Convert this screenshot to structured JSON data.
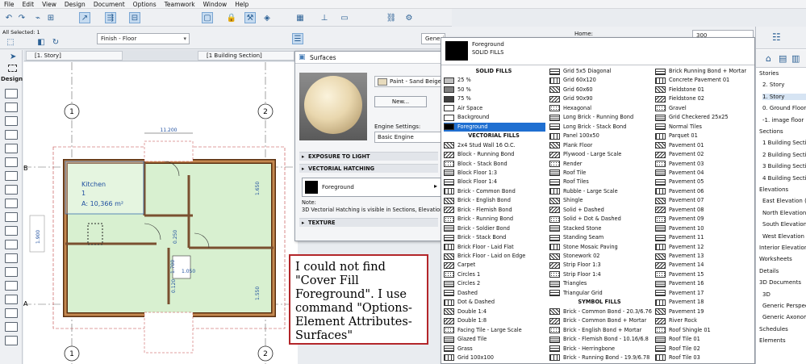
{
  "menu": [
    "File",
    "Edit",
    "View",
    "Design",
    "Document",
    "Options",
    "Teamwork",
    "Window",
    "Help"
  ],
  "infobox": {
    "selection": "All Selected: 1",
    "layer": "Finish - Floor",
    "home_label": "Home:",
    "home_value": "300",
    "generic": "Generic"
  },
  "tabs": [
    "[1. Story]",
    "[1 Building Section]"
  ],
  "left_panel_label": "Design",
  "plan": {
    "room_name": "Kitchen",
    "room_number": "1",
    "room_area": "A: 10,366 m²",
    "grid_labels": [
      "1",
      "2",
      "1",
      "2"
    ],
    "dims": [
      "11.200",
      "1.650",
      "1.550",
      "1.900",
      "0.250",
      "1.700",
      "1.050",
      "0.120"
    ],
    "side_labels": [
      "B",
      "A"
    ]
  },
  "surfaces_dialog": {
    "title": "Surfaces",
    "material_name": "Paint - Sand Beige",
    "new_button": "New...",
    "engine_label": "Engine Settings:",
    "engine_value": "Basic Engine",
    "sections": [
      "EXPOSURE TO LIGHT",
      "VECTORIAL HATCHING",
      "TEXTURE"
    ],
    "hatch_value": "Foreground",
    "note_label": "Note:",
    "note_text": "3D Vectorial Hatching is visible in Sections, Elevation"
  },
  "palette": {
    "header_name": "Foreground",
    "header_sub": "SOLID FILLS",
    "selected": "Foreground",
    "col1": [
      {
        "h": "SOLID FILLS"
      },
      "25 %",
      "50 %",
      "75 %",
      "Air Space",
      "Background",
      "Foreground",
      {
        "h": "VECTORIAL FILLS"
      },
      "2x4 Stud Wall 16 O.C.",
      "Block - Running Bond",
      "Block - Stack Bond",
      "Block Floor 1:3",
      "Block Floor 1:4",
      "Brick - Common Bond",
      "Brick - English Bond",
      "Brick - Flemish Bond",
      "Brick - Running Bond",
      "Brick - Soldier Bond",
      "Brick - Stack Bond",
      "Brick Floor - Laid Flat",
      "Brick Floor - Laid on Edge",
      "Carpet",
      "Circles 1",
      "Circles 2",
      "Dashed",
      "Dot & Dashed",
      "Double 1:4",
      "Double 1:8",
      "Facing Tile - Large Scale",
      "Glazed Tile",
      "Grass",
      "Grid 100x100"
    ],
    "col2": [
      "Grid 5x5 Diagonal",
      "Grid 60x120",
      "Grid 60x60",
      "Grid 90x90",
      "Hexagonal",
      "Long Brick - Running Bond",
      "Long Brick - Stack Bond",
      "Panel 100x50",
      "Plank Floor",
      "Plywood - Large Scale",
      "Render",
      "Roof Tile",
      "Roof Tiles",
      "Rubble - Large Scale",
      "Shingle",
      "Solid + Dashed",
      "Solid + Dot & Dashed",
      "Stacked Stone",
      "Standing Seam",
      "Stone Mosaic Paving",
      "Stonework 02",
      "Strip Floor 1:3",
      "Strip Floor 1:4",
      "Triangles",
      "Triangular Grid",
      {
        "h": "SYMBOL FILLS"
      },
      "Brick - Common Bond - 20.3/6.76",
      "Brick - Common Bond + Mortar",
      "Brick - English Bond + Mortar",
      "Brick - Flemish Bond - 10.16/6.8",
      "Brick - Herringbone",
      "Brick - Running Bond - 19.9/6.78"
    ],
    "col3": [
      "Brick Running Bond + Mortar",
      "Concrete Pavement 01",
      "Fieldstone 01",
      "Fieldstone 02",
      "Gravel",
      "Grid Checkered 25x25",
      "Normal Tiles",
      "Parquet 01",
      "Pavement 01",
      "Pavement 02",
      "Pavement 03",
      "Pavement 04",
      "Pavement 05",
      "Pavement 06",
      "Pavement 07",
      "Pavement 08",
      "Pavement 09",
      "Pavement 10",
      "Pavement 11",
      "Pavement 12",
      "Pavement 13",
      "Pavement 14",
      "Pavement 15",
      "Pavement 16",
      "Pavement 17",
      "Pavement 18",
      "Pavement 19",
      "River Rock",
      "Roof Shingle 01",
      "Roof Tile 01",
      "Roof Tile 02",
      "Roof Tile 03"
    ]
  },
  "navigator": [
    "Stories",
    "2. Story",
    "1. Story",
    "0. Ground Floor",
    "-1. image floor",
    "Sections",
    "1 Building Section",
    "2 Building Section",
    "3 Building Section",
    "4 Building Section",
    "Elevations",
    "East Elevation (A",
    "North Elevation",
    "South Elevation",
    "West Elevation (A",
    "Interior Elevations",
    "Worksheets",
    "Details",
    "3D Documents",
    "3D",
    "Generic Perspect",
    "Generic Axonom",
    "Schedules",
    "Elements"
  ],
  "annotation": "I could not find \"Cover Fill Foreground\". I use command \"Options-Element Attributes-Surfaces\""
}
